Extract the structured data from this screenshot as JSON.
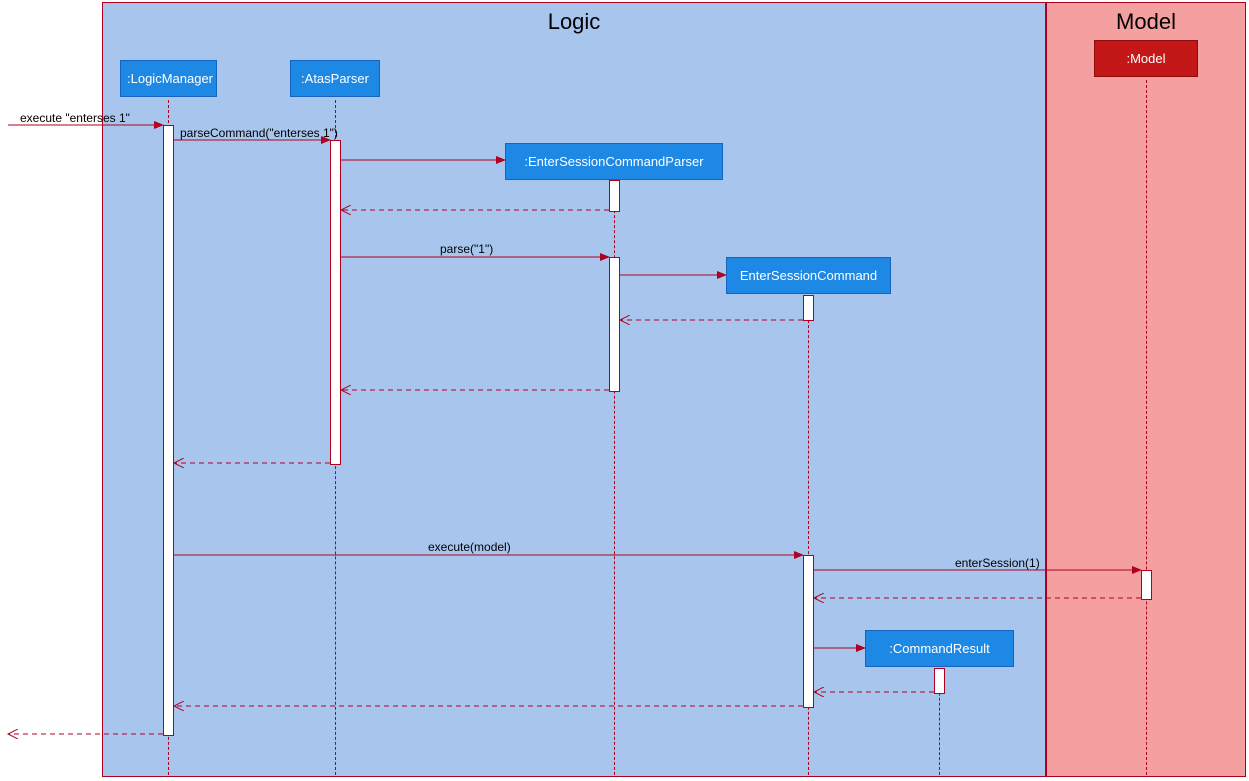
{
  "frames": {
    "logic": "Logic",
    "model": "Model"
  },
  "participants": {
    "logicManager": ":LogicManager",
    "atasParser": ":AtasParser",
    "enterSessionCommandParser": ":EnterSessionCommandParser",
    "enterSessionCommand": "EnterSessionCommand",
    "model": ":Model",
    "commandResult": ":CommandResult"
  },
  "messages": {
    "execute_enterses": "execute \"enterses 1\"",
    "parseCommand": "parseCommand(\"enterses 1\")",
    "parse": "parse(\"1\")",
    "execute_model": "execute(model)",
    "enterSession": "enterSession(1)"
  }
}
